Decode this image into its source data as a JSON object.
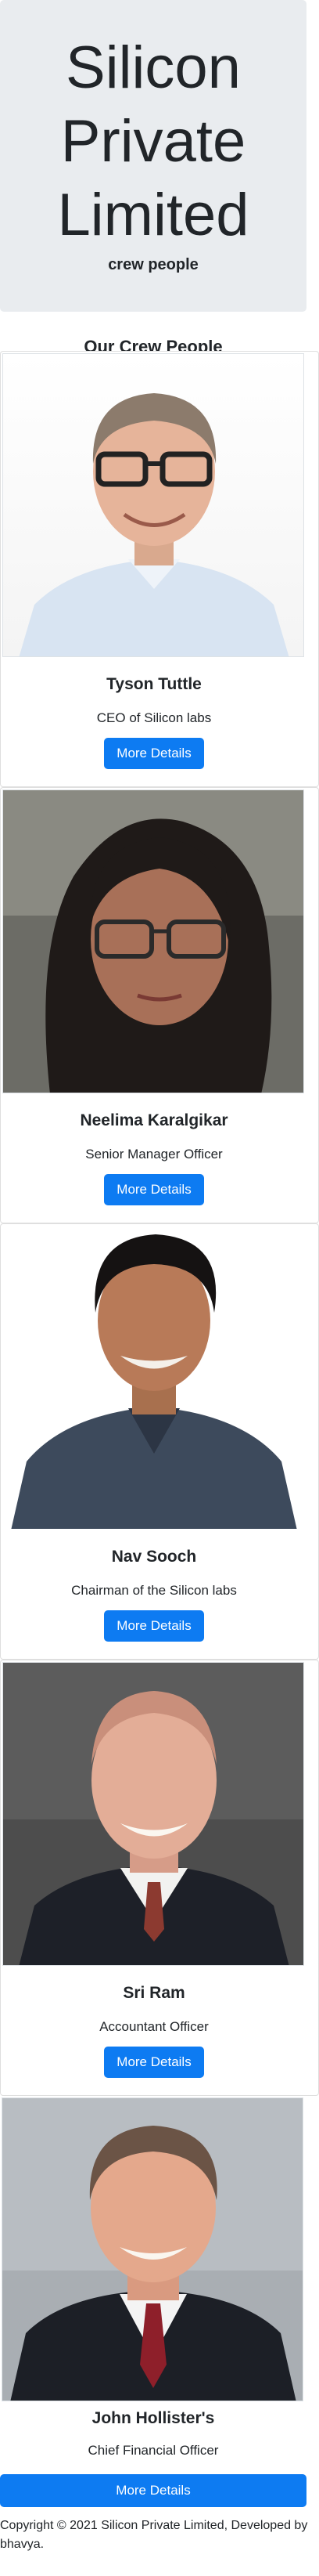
{
  "hero": {
    "title": "Silicon Private Limited",
    "subtitle": "crew people"
  },
  "section": {
    "heading": "Our Crew People"
  },
  "crew": [
    {
      "name": "Tyson Tuttle",
      "role": "CEO of Silicon labs",
      "button": "More Details",
      "photo": "man-glasses-photo"
    },
    {
      "name": "Neelima Karalgikar",
      "role": "Senior Manager Officer",
      "button": "More Details",
      "photo": "woman-glasses-photo"
    },
    {
      "name": "Nav Sooch",
      "role": "Chairman of the Silicon labs",
      "button": "More Details",
      "photo": "man-smiling-photo"
    },
    {
      "name": "Sri Ram",
      "role": "Accountant Officer",
      "button": "More Details",
      "photo": "bald-man-photo"
    },
    {
      "name": "John Hollister's",
      "role": "Chief Financial Officer",
      "button": "More Details",
      "photo": "man-suit-photo"
    }
  ],
  "footer": {
    "copyright": "Copyright © 2021 Silicon Private Limited, Developed by bhavya."
  },
  "colors": {
    "hero_bg": "#e9ecef",
    "button_bg": "#0d7bf2",
    "text": "#212529"
  }
}
